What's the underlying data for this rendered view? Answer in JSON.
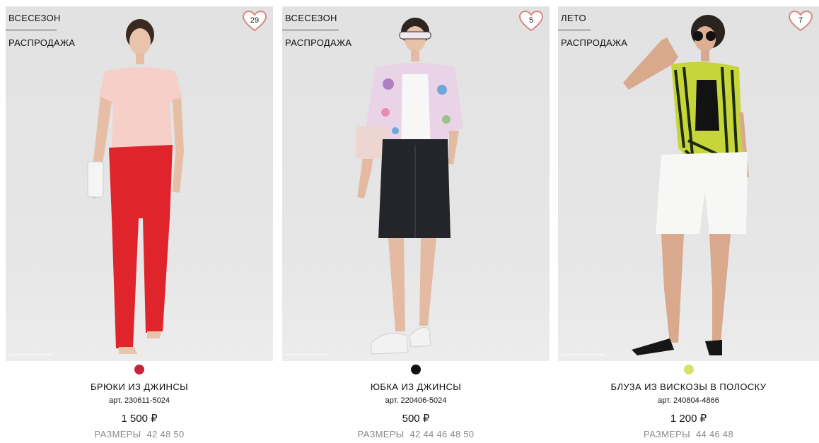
{
  "products": [
    {
      "tags": [
        "ВСЕСЕЗОН",
        "РАСПРОДАЖА"
      ],
      "favorites_count": "29",
      "color": "#c8233a",
      "name": "БРЮКИ ИЗ ДЖИНСЫ",
      "article": "арт. 230611-5024",
      "price": "1 500 ₽",
      "sizes_label": "РАЗМЕРЫ",
      "sizes": "42 48 50"
    },
    {
      "tags": [
        "ВСЕСЕЗОН",
        "РАСПРОДАЖА"
      ],
      "favorites_count": "5",
      "color": "#111111",
      "name": "ЮБКА ИЗ ДЖИНСЫ",
      "article": "арт. 220406-5024",
      "price": "500 ₽",
      "sizes_label": "РАЗМЕРЫ",
      "sizes": "42 44 46 48 50"
    },
    {
      "tags": [
        "ЛЕТО",
        "РАСПРОДАЖА"
      ],
      "favorites_count": "7",
      "color": "#d6e06a",
      "name": "БЛУЗА ИЗ ВИСКОЗЫ В ПОЛОСКУ",
      "article": "арт. 240804-4866",
      "price": "1 200 ₽",
      "sizes_label": "РАЗМЕРЫ",
      "sizes": "44 46 48"
    }
  ],
  "icons": {
    "favorite": "heart-icon"
  },
  "accent_colors": {
    "heart": "#d98585",
    "sizes_text": "#8a8a8a"
  }
}
